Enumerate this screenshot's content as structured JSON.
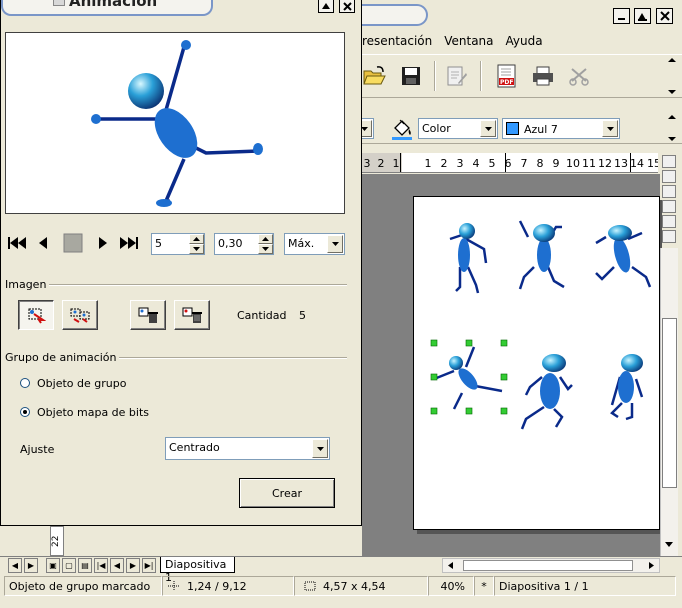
{
  "main_window": {
    "menu": [
      "resentación",
      "Ventana",
      "Ayuda"
    ],
    "format_toolbar": {
      "area_style": "Color",
      "fill_color": "Azul 7",
      "fill_color_hex": "#3399ff"
    },
    "ruler_numbers": [
      "3",
      "2",
      "1",
      "",
      "1",
      "2",
      "3",
      "4",
      "5",
      "6",
      "7",
      "8",
      "9",
      "10",
      "11",
      "12",
      "13",
      "14",
      "15"
    ],
    "slide_tab": "Diapositiva 1",
    "left_vertical_ruler": "22",
    "status": {
      "object": "Objeto de grupo marcado",
      "position": "1,24 / 9,12",
      "size": "4,57 x 4,54",
      "zoom": "40%",
      "modified": "*",
      "slide": "Diapositiva 1 / 1"
    }
  },
  "dialog": {
    "title": "Animación",
    "frame_number": "5",
    "duration": "0,30",
    "loop": "Máx.",
    "image_section": "Imagen",
    "count_label": "Cantidad",
    "count_value": "5",
    "group_section": "Grupo de animación",
    "radio_group_object": "Objeto de grupo",
    "radio_bitmap_object": "Objeto mapa de bits",
    "selected_radio": "bitmap",
    "alignment_label": "Ajuste",
    "alignment_value": "Centrado",
    "create_button": "Crear"
  },
  "colors": {
    "figure_blue": "#1e6fd0",
    "figure_dark": "#0a2a8a",
    "selection_handle": "#33cc33"
  }
}
